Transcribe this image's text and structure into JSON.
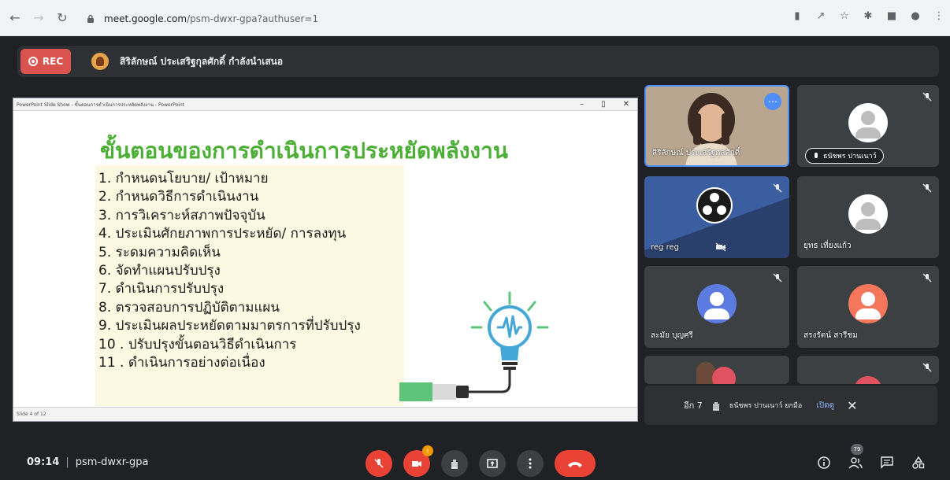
{
  "browser": {
    "url_host": "meet.google.com",
    "url_path": "/psm-dwxr-gpa?authuser=1"
  },
  "recording": {
    "badge": "REC",
    "presenter_text": "สิริลักษณ์ ประเสริฐกุลศักดิ์ กำลังนำเสนอ"
  },
  "slide": {
    "window_title": "PowerPoint Slide Show - ขั้นตอนการดำเนินการประหยัดพลังงาน - PowerPoint",
    "title": "ขั้นตอนของการดำเนินการประหยัดพลังงาน",
    "steps": [
      "1. กำหนดนโยบาย/ เป้าหมาย",
      "2. กำหนดวิธีการดำเนินงาน",
      "3. การวิเคราะห์สภาพปัจจุบัน",
      "4. ประเมินศักยภาพการประหยัด/ การลงทุน",
      "5. ระดมความคิดเห็น",
      "6. จัดทำแผนปรับปรุง",
      "7. ดำเนินการปรับปรุง",
      "8. ตรวจสอบการปฏิบัติตามแผน",
      "9. ประเมินผลประหยัดตามมาตรการที่ปรับปรุง",
      "10 . ปรับปรุงขั้นตอนวิธีดำเนินการ",
      "11 . ดำเนินการอย่างต่อเนื่อง"
    ],
    "status_left": "Slide 4 of 12"
  },
  "participants": {
    "presenter_cam_name": "สิริลักษณ์ ประเสริฐกุลศักดิ์",
    "chip_name": "ธนัชพร ปานเนาว์",
    "reg": "reg reg",
    "yuttho": "ยุทธ เที่ยงแก้ว",
    "lamai": "ละมัย บุญศรี",
    "sarongrat": "สรงรัตน์ สารีชม"
  },
  "notification": {
    "more": "อีก 7",
    "text": "ธนัชพร ปานเนาว์ ยกมือ",
    "open": "เปิดดู"
  },
  "controls": {
    "time": "09:14",
    "code": "psm-dwxr-gpa",
    "camera_badge": "!",
    "people_count": "79"
  }
}
